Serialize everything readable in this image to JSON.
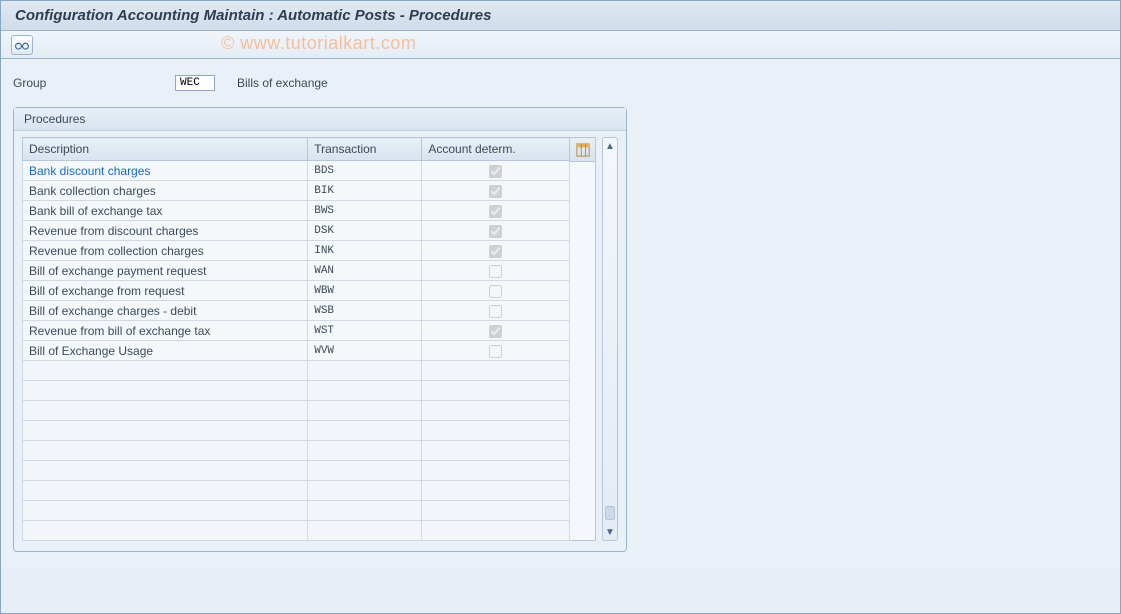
{
  "title": "Configuration Accounting Maintain : Automatic Posts - Procedures",
  "watermark": "© www.tutorialkart.com",
  "group": {
    "label": "Group",
    "value": "WEC",
    "description": "Bills of exchange"
  },
  "panel": {
    "title": "Procedures"
  },
  "columns": {
    "description": "Description",
    "transaction": "Transaction",
    "account_determ": "Account determ."
  },
  "rows": [
    {
      "description": "Bank discount charges",
      "transaction": "BDS",
      "account_determ": true,
      "link": true
    },
    {
      "description": "Bank collection charges",
      "transaction": "BIK",
      "account_determ": true
    },
    {
      "description": "Bank bill of exchange tax",
      "transaction": "BWS",
      "account_determ": true
    },
    {
      "description": "Revenue from discount charges",
      "transaction": "DSK",
      "account_determ": true
    },
    {
      "description": "Revenue from collection charges",
      "transaction": "INK",
      "account_determ": true
    },
    {
      "description": "Bill of exchange payment request",
      "transaction": "WAN",
      "account_determ": false
    },
    {
      "description": "Bill of exchange from request",
      "transaction": "WBW",
      "account_determ": false
    },
    {
      "description": "Bill of exchange charges - debit",
      "transaction": "WSB",
      "account_determ": false
    },
    {
      "description": "Revenue from bill of exchange tax",
      "transaction": "WST",
      "account_determ": true
    },
    {
      "description": "Bill of Exchange Usage",
      "transaction": "WVW",
      "account_determ": false
    }
  ],
  "empty_rows": 9,
  "icons": {
    "toolbar_button": "display-icon",
    "settings": "table-settings-icon"
  }
}
